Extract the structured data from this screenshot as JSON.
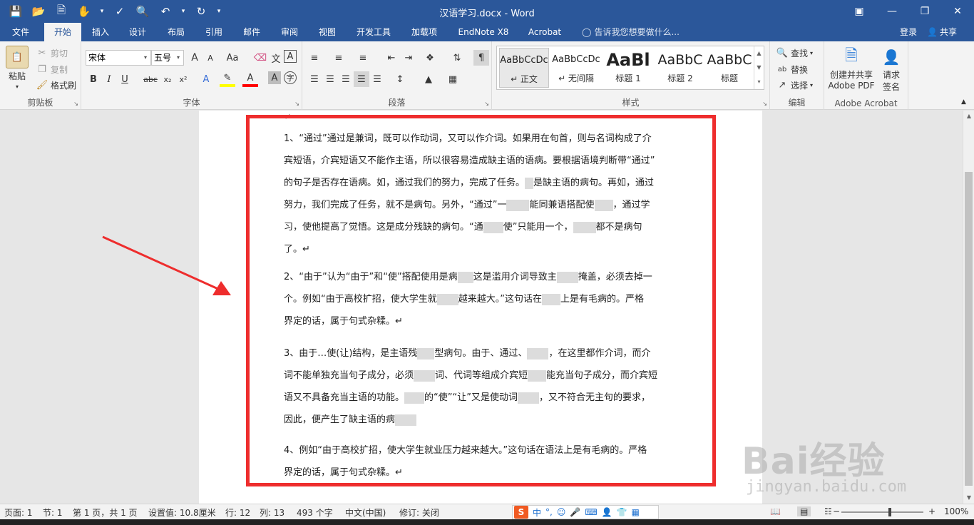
{
  "title_bar": {
    "document_title": "汉语学习.docx - Word",
    "qat_icons": [
      "save-icon",
      "open-icon",
      "new-icon",
      "touch-mode-icon",
      "spelling-icon",
      "print-preview-icon",
      "undo-icon",
      "redo-icon",
      "customize-qat-icon"
    ]
  },
  "tabs": [
    "文件",
    "开始",
    "插入",
    "设计",
    "布局",
    "引用",
    "邮件",
    "审阅",
    "视图",
    "开发工具",
    "加载项",
    "EndNote X8",
    "Acrobat"
  ],
  "active_tab": "开始",
  "tell_me": "告诉我您想要做什么...",
  "login": "登录",
  "share": "共享",
  "ribbon": {
    "clipboard": {
      "label": "剪贴板",
      "paste": "粘贴",
      "cut": "剪切",
      "copy": "复制",
      "format_painter": "格式刷"
    },
    "font": {
      "label": "字体",
      "font_name": "宋体",
      "font_size": "五号",
      "grow": "A",
      "shrink": "A",
      "case": "Aa",
      "bold": "B",
      "italic": "I",
      "underline": "U",
      "strike": "abc",
      "subscript": "x₂",
      "superscript": "x²",
      "highlight_color": "#ffff00",
      "font_color": "#ff0000"
    },
    "paragraph": {
      "label": "段落"
    },
    "styles": {
      "label": "样式",
      "items": [
        {
          "sample": "AaBbCcDc",
          "name": "↵ 正文"
        },
        {
          "sample": "AaBbCcDc",
          "name": "↵ 无间隔"
        },
        {
          "sample": "AaBl",
          "name": "标题 1"
        },
        {
          "sample": "AaBbC",
          "name": "标题 2"
        },
        {
          "sample": "AaBbC",
          "name": "标题"
        }
      ]
    },
    "editing": {
      "label": "编辑",
      "find": "查找",
      "replace": "替换",
      "select": "选择"
    },
    "acrobat": {
      "label": "Adobe Acrobat",
      "create_share_1": "创建并共享",
      "create_share_2": "Adobe PDF",
      "request_sign_1": "请求",
      "request_sign_2": "签名"
    }
  },
  "document": {
    "top_mark": "↵",
    "paragraphs": [
      {
        "lines": [
          "1、“通过”通过是兼词，既可以作动词，又可以作介词。如果用在句首，则与名词构成了介",
          "宾短语，介宾短语又不能作主语，所以很容易造成缺主语的语病。要根据语境判断带“通过”",
          "的句子是否存在语病。如，通过我们的努力，完成了任务。",
          "努力，我们完成了任务，就不是病句。另外，“通过”一",
          "习，使他提高了觉悟。这是成分残缺的病句。“通",
          "了。↵"
        ]
      },
      {
        "lines": [
          "2、“由于”认为“由于”和“使”搭配使用是病",
          "个。例如“由于高校扩招，使大学生就",
          "界定的话，属于句式杂糅。↵"
        ]
      },
      {
        "lines": [
          "3、由于…使(让)结构，是主语残",
          "词不能单独充当句子成分，必须",
          "语又不具备充当主语的功能。",
          "因此，便产生了缺主语的病"
        ]
      },
      {
        "lines": [
          "4、例如“由于高校扩招，使大学生就业压力越来越大。”这句话在语法上是有毛病的。严格",
          "界定的话，属于句式杂糅。↵"
        ]
      }
    ],
    "fragments": {
      "p1_l3_b": "是缺主语的病句。再如，通过",
      "p1_l4_b": "能同兼语搭配使",
      "p1_l4_c": "，通过学",
      "p1_l5_b": "使”只能用一个，",
      "p1_l5_c": "都不是病句",
      "p2_l1_b": "这是滥用介词导致主",
      "p2_l1_c": "掩盖，必须去掉一",
      "p2_l2_b": "越来越大。”这句话在",
      "p2_l2_c": "上是有毛病的。严格",
      "p3_l1_b": "型病句。由于、通过、",
      "p3_l1_c": "，在这里都作介词，而介",
      "p3_l2_b": "词、代词等组成介宾短",
      "p3_l2_c": "能充当句子成分，而介宾短",
      "p3_l3_b": "的“使”“让”又是使动词",
      "p3_l3_c": "，又不符合无主句的要求，"
    },
    "highlight_color": "#ee2d2d"
  },
  "status_bar": {
    "page": "页面: 1",
    "section": "节: 1",
    "page_of": "第 1 页，共 1 页",
    "position": "设置值: 10.8厘米",
    "line": "行: 12",
    "column": "列: 13",
    "word_count": "493 个字",
    "language": "中文(中国)",
    "track_changes": "修订: 关闭",
    "ime_logo": "S",
    "ime_mode": "中",
    "zoom": "100%",
    "zoom_minus": "−",
    "zoom_plus": "+"
  },
  "watermark": {
    "main": "Bai经验",
    "sub": "jingyan.baidu.com"
  }
}
